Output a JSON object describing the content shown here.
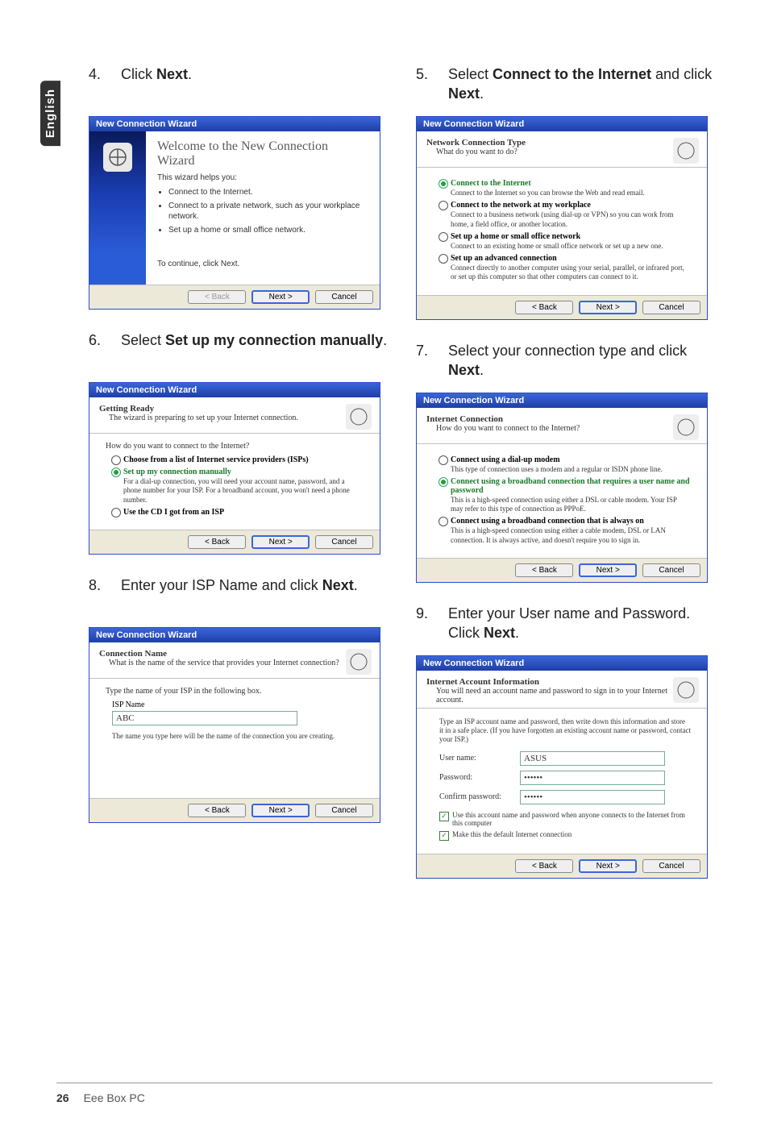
{
  "page": {
    "language_tab": "English",
    "number": "26",
    "product": "Eee Box PC"
  },
  "wizard_common": {
    "window_title": "New Connection Wizard",
    "btn_back": "< Back",
    "btn_next": "Next >",
    "btn_cancel": "Cancel"
  },
  "steps": {
    "s4": {
      "num": "4.",
      "text_pre": "Click ",
      "text_bold": "Next",
      "text_post": ".",
      "dialog": {
        "title": "Welcome to the New Connection Wizard",
        "lead": "This wizard helps you:",
        "bullets": [
          "Connect to the Internet.",
          "Connect to a private network, such as your workplace network.",
          "Set up a home or small office network."
        ],
        "continue": "To continue, click Next."
      }
    },
    "s5": {
      "num": "5.",
      "text_pre": "Select ",
      "text_bold": "Connect to the Internet",
      "text_mid": " and click ",
      "text_bold2": "Next",
      "text_post": ".",
      "dialog": {
        "h_title": "Network Connection Type",
        "h_sub": "What do you want to do?",
        "options": [
          {
            "title": "Connect to the Internet",
            "desc": "Connect to the Internet so you can browse the Web and read email.",
            "selected": true
          },
          {
            "title": "Connect to the network at my workplace",
            "desc": "Connect to a business network (using dial-up or VPN) so you can work from home, a field office, or another location.",
            "selected": false
          },
          {
            "title": "Set up a home or small office network",
            "desc": "Connect to an existing home or small office network or set up a new one.",
            "selected": false
          },
          {
            "title": "Set up an advanced connection",
            "desc": "Connect directly to another computer using your serial, parallel, or infrared port, or set up this computer so that other computers can connect to it.",
            "selected": false
          }
        ]
      }
    },
    "s6": {
      "num": "6.",
      "text_pre": "Select ",
      "text_bold": "Set up my connection manually",
      "text_post": ".",
      "dialog": {
        "h_title": "Getting Ready",
        "h_sub": "The wizard is preparing to set up your Internet connection.",
        "prompt": "How do you want to connect to the Internet?",
        "options": [
          {
            "title": "Choose from a list of Internet service providers (ISPs)",
            "desc": "",
            "selected": false
          },
          {
            "title": "Set up my connection manually",
            "desc": "For a dial-up connection, you will need your account name, password, and a phone number for your ISP. For a broadband account, you won't need a phone number.",
            "selected": true
          },
          {
            "title": "Use the CD I got from an ISP",
            "desc": "",
            "selected": false
          }
        ]
      }
    },
    "s7": {
      "num": "7.",
      "text_pre": "Select your connection type and click ",
      "text_bold": "Next",
      "text_post": ".",
      "dialog": {
        "h_title": "Internet Connection",
        "h_sub": "How do you want to connect to the Internet?",
        "options": [
          {
            "title": "Connect using a dial-up modem",
            "desc": "This type of connection uses a modem and a regular or ISDN phone line.",
            "selected": false
          },
          {
            "title": "Connect using a broadband connection that requires a user name and password",
            "desc": "This is a high-speed connection using either a DSL or cable modem. Your ISP may refer to this type of connection as PPPoE.",
            "selected": true
          },
          {
            "title": "Connect using a broadband connection that is always on",
            "desc": "This is a high-speed connection using either a cable modem, DSL or LAN connection. It is always active, and doesn't require you to sign in.",
            "selected": false
          }
        ]
      }
    },
    "s8": {
      "num": "8.",
      "text_pre": "Enter your ISP Name and click ",
      "text_bold": "Next",
      "text_post": ".",
      "dialog": {
        "h_title": "Connection Name",
        "h_sub": "What is the name of the service that provides your Internet connection?",
        "prompt": "Type the name of your ISP in the following box.",
        "field_label": "ISP Name",
        "field_value": "ABC",
        "note": "The name you type here will be the name of the connection you are creating."
      }
    },
    "s9": {
      "num": "9.",
      "text_pre": "Enter your User name and Password. Click ",
      "text_bold": "Next",
      "text_post": ".",
      "dialog": {
        "h_title": "Internet Account Information",
        "h_sub": "You will need an account name and password to sign in to your Internet account.",
        "intro": "Type an ISP account name and password, then write down this information and store it in a safe place. (If you have forgotten an existing account name or password, contact your ISP.)",
        "user_label": "User name:",
        "user_value": "ASUS",
        "pass_label": "Password:",
        "pass_value": "••••••",
        "confirm_label": "Confirm password:",
        "confirm_value": "••••••",
        "chk1": "Use this account name and password when anyone connects to the Internet from this computer",
        "chk2": "Make this the default Internet connection"
      }
    }
  }
}
